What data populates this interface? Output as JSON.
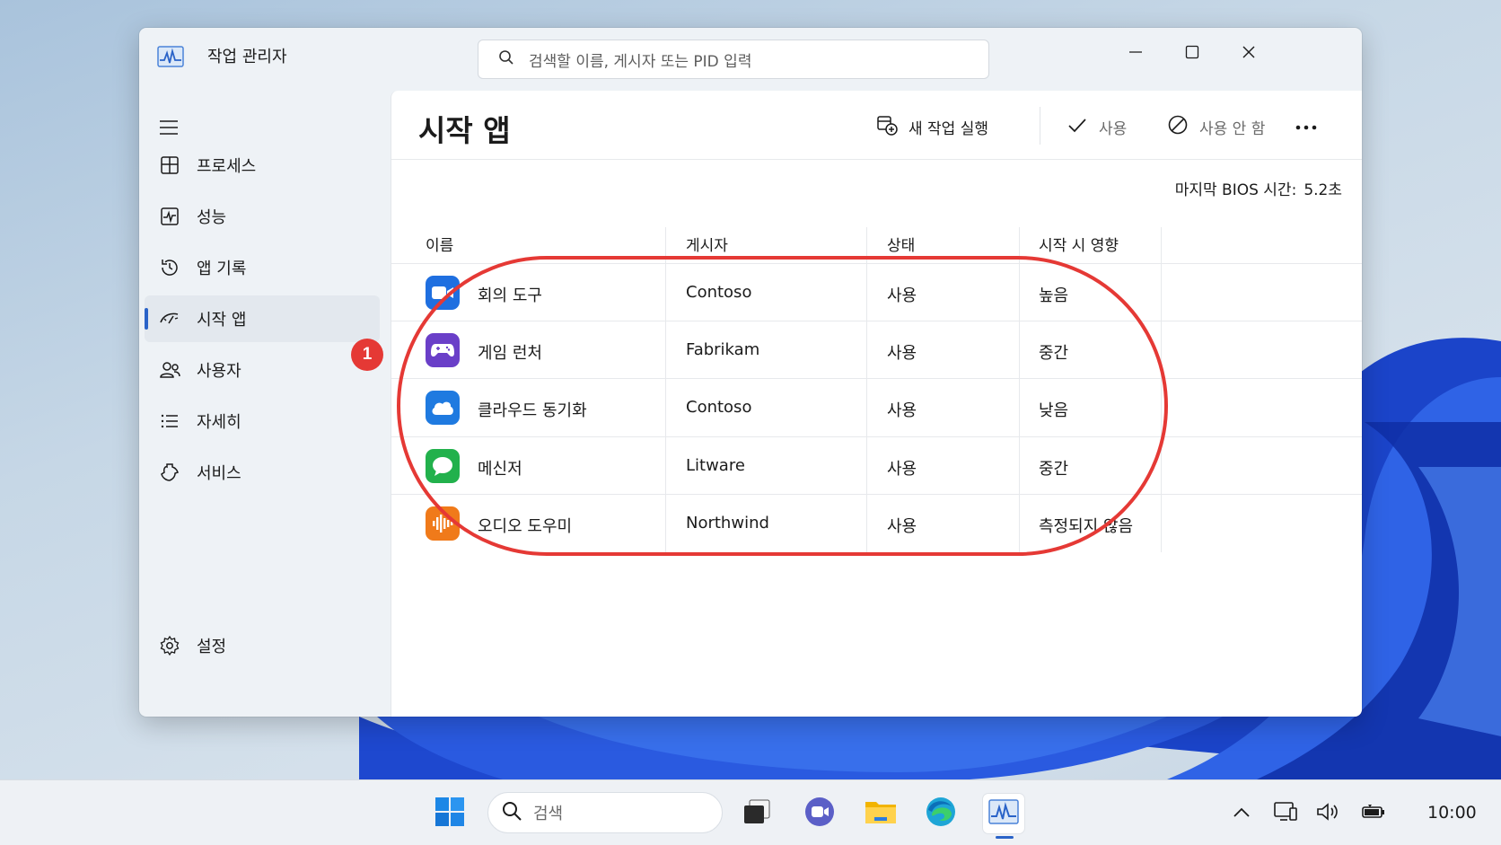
{
  "window": {
    "title": "작업 관리자",
    "search_placeholder": "검색할 이름, 게시자 또는 PID 입력"
  },
  "sidebar": {
    "items": [
      {
        "label": "프로세스",
        "icon": "processes-icon"
      },
      {
        "label": "성능",
        "icon": "performance-icon"
      },
      {
        "label": "앱 기록",
        "icon": "app-history-icon"
      },
      {
        "label": "시작 앱",
        "icon": "startup-apps-icon",
        "active": true
      },
      {
        "label": "사용자",
        "icon": "users-icon"
      },
      {
        "label": "자세히",
        "icon": "details-icon"
      },
      {
        "label": "서비스",
        "icon": "services-icon"
      }
    ],
    "settings_label": "설정",
    "badge": "1"
  },
  "main": {
    "title": "시작 앱",
    "toolbar": {
      "run_new_task": "새 작업 실행",
      "enable": "사용",
      "disable": "사용 안 함"
    },
    "bios_label": "마지막 BIOS 시간:",
    "bios_value": "5.2초",
    "columns": [
      "이름",
      "게시자",
      "상태",
      "시작 시 영향"
    ],
    "rows": [
      {
        "name": "회의 도구",
        "publisher": "Contoso",
        "status": "사용",
        "impact": "높음",
        "icon": "meeting-tool-icon",
        "color": "#1f6fe0"
      },
      {
        "name": "게임 런처",
        "publisher": "Fabrikam",
        "status": "사용",
        "impact": "중간",
        "icon": "game-launcher-icon",
        "color": "#6a3fc8"
      },
      {
        "name": "클라우드 동기화",
        "publisher": "Contoso",
        "status": "사용",
        "impact": "낮음",
        "icon": "cloud-sync-icon",
        "color": "#1f7ae0"
      },
      {
        "name": "메신저",
        "publisher": "Litware",
        "status": "사용",
        "impact": "중간",
        "icon": "messenger-icon",
        "color": "#22b14c"
      },
      {
        "name": "오디오 도우미",
        "publisher": "Northwind",
        "status": "사용",
        "impact": "측정되지 않음",
        "icon": "audio-helper-icon",
        "color": "#f07a1a"
      }
    ]
  },
  "taskbar": {
    "search_placeholder": "검색",
    "clock": "10:00"
  },
  "colors": {
    "accent": "#2a63c8",
    "annotation": "#e53935"
  }
}
